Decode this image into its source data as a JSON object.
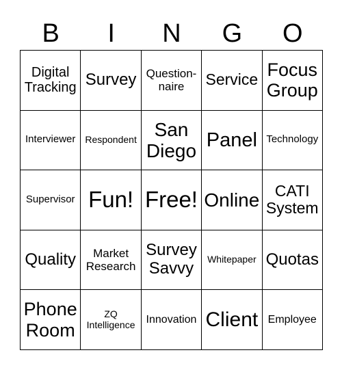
{
  "header": [
    "B",
    "I",
    "N",
    "G",
    "O"
  ],
  "cells": [
    [
      {
        "t": "Digital Tracking",
        "s": 20
      },
      {
        "t": "Survey",
        "s": 24
      },
      {
        "t": "Question-naire",
        "s": 17
      },
      {
        "t": "Service",
        "s": 23
      },
      {
        "t": "Focus Group",
        "s": 27
      }
    ],
    [
      {
        "t": "Interviewer",
        "s": 15
      },
      {
        "t": "Respondent",
        "s": 14
      },
      {
        "t": "San Diego",
        "s": 28
      },
      {
        "t": "Panel",
        "s": 29
      },
      {
        "t": "Technology",
        "s": 15
      }
    ],
    [
      {
        "t": "Supervisor",
        "s": 15
      },
      {
        "t": "Fun!",
        "s": 33
      },
      {
        "t": "Free!",
        "s": 33
      },
      {
        "t": "Online",
        "s": 28
      },
      {
        "t": "CATI System",
        "s": 23
      }
    ],
    [
      {
        "t": "Quality",
        "s": 24
      },
      {
        "t": "Market Research",
        "s": 17
      },
      {
        "t": "Survey Savvy",
        "s": 24
      },
      {
        "t": "Whitepaper",
        "s": 14
      },
      {
        "t": "Quotas",
        "s": 24
      }
    ],
    [
      {
        "t": "Phone Room",
        "s": 27
      },
      {
        "t": "ZQ Intelligence",
        "s": 14
      },
      {
        "t": "Innovation",
        "s": 16
      },
      {
        "t": "Client",
        "s": 30
      },
      {
        "t": "Employee",
        "s": 16
      }
    ]
  ]
}
